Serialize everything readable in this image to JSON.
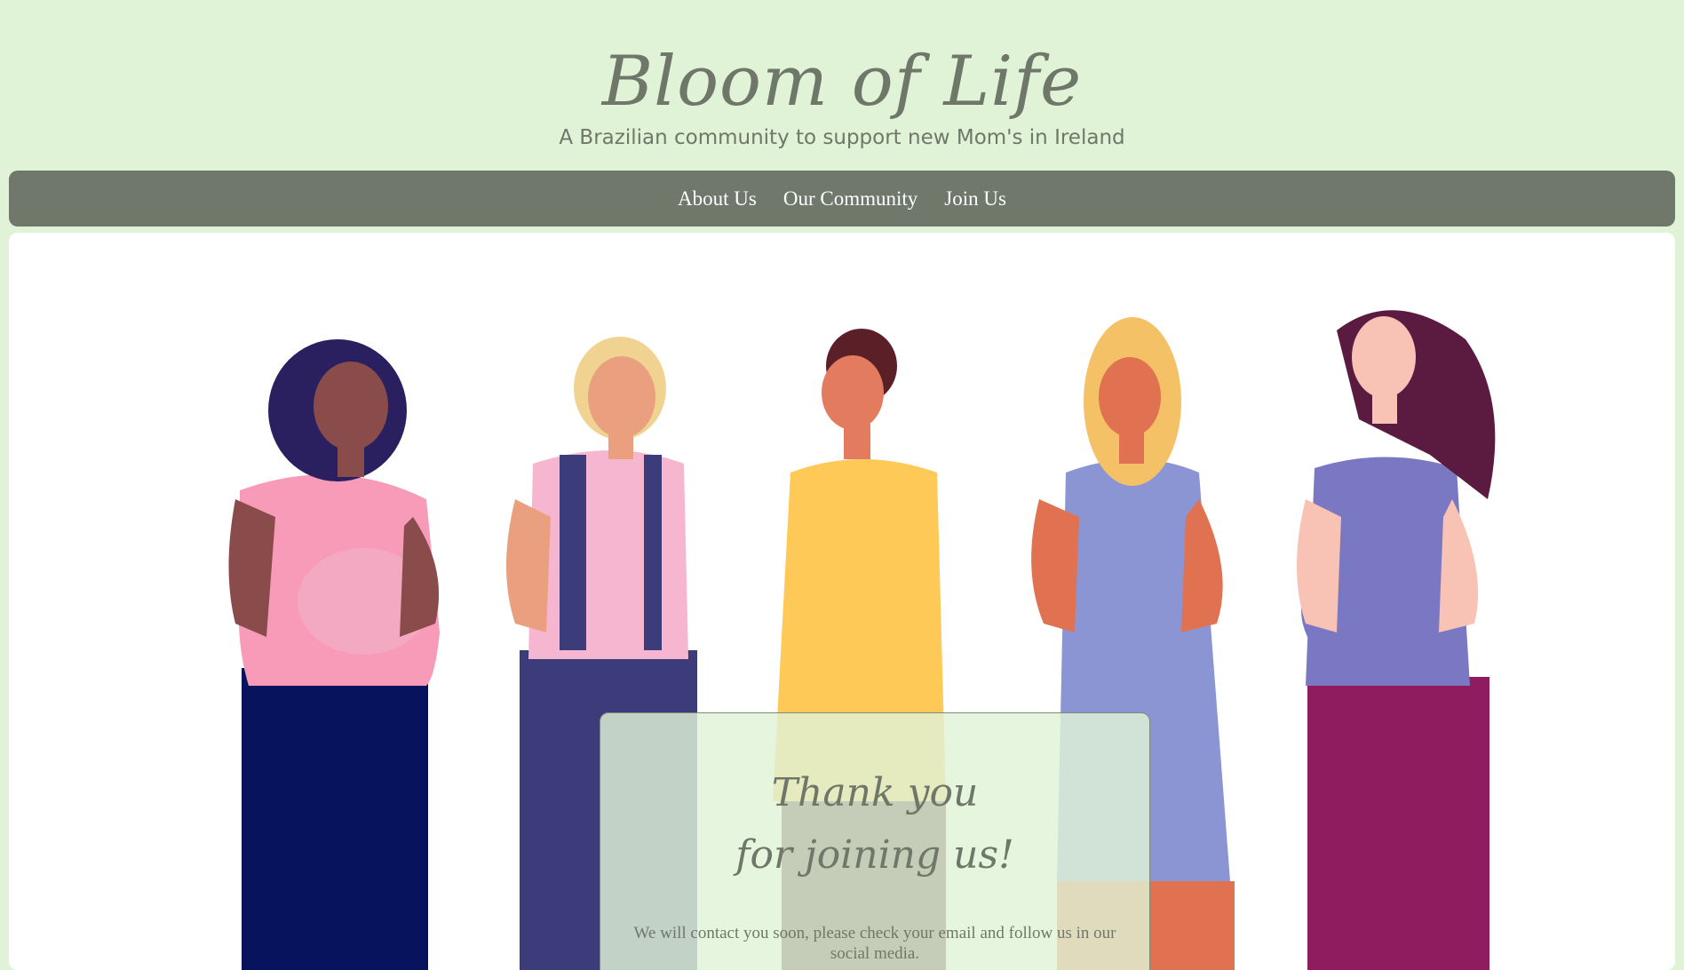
{
  "header": {
    "title": "Bloom of Life",
    "tagline": "A Brazilian community to support new Mom's in Ireland"
  },
  "nav": {
    "items": [
      {
        "label": "About Us"
      },
      {
        "label": "Our Community"
      },
      {
        "label": "Join Us"
      }
    ]
  },
  "card": {
    "title_line1": "Thank you",
    "title_line2": "for joining us!",
    "message": "We will contact you soon, please check your email and follow us in our social media."
  },
  "colors": {
    "page_background": "#e1f3d7",
    "nav_background": "#6f786a",
    "text_primary": "#6f7769",
    "content_background": "#ffffff"
  },
  "illustration": {
    "name": "five-pregnant-women-illustration"
  }
}
